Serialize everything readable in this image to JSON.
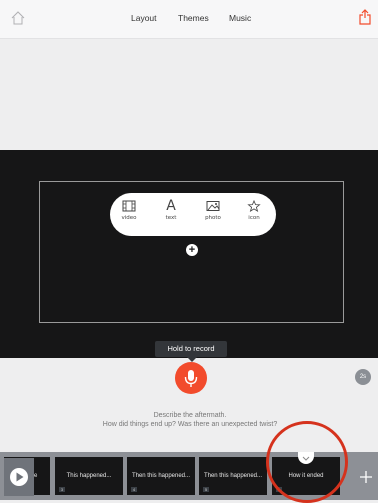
{
  "topbar": {
    "tabs": [
      "Layout",
      "Themes",
      "Music"
    ]
  },
  "popup": {
    "options": [
      {
        "label": "video",
        "icon": "film-icon"
      },
      {
        "label": "text",
        "icon": "text-icon"
      },
      {
        "label": "photo",
        "icon": "photo-icon"
      },
      {
        "label": "icon",
        "icon": "star-icon"
      }
    ]
  },
  "record": {
    "tooltip": "Hold to record",
    "duration_badge": "2s"
  },
  "prompt": {
    "line1": "Describe the aftermath.",
    "line2": "How did things end up? Was there an unexpected twist?"
  },
  "filmstrip": {
    "slides": [
      {
        "label": "re",
        "number": ""
      },
      {
        "label": "This happened...",
        "number": "3"
      },
      {
        "label": "Then this happened...",
        "number": "4"
      },
      {
        "label": "Then this happened...",
        "number": "5"
      },
      {
        "label": "How it ended",
        "number": "6"
      }
    ]
  },
  "colors": {
    "accent": "#f24b2c",
    "stage": "#161617",
    "highlight": "#d5321d"
  }
}
